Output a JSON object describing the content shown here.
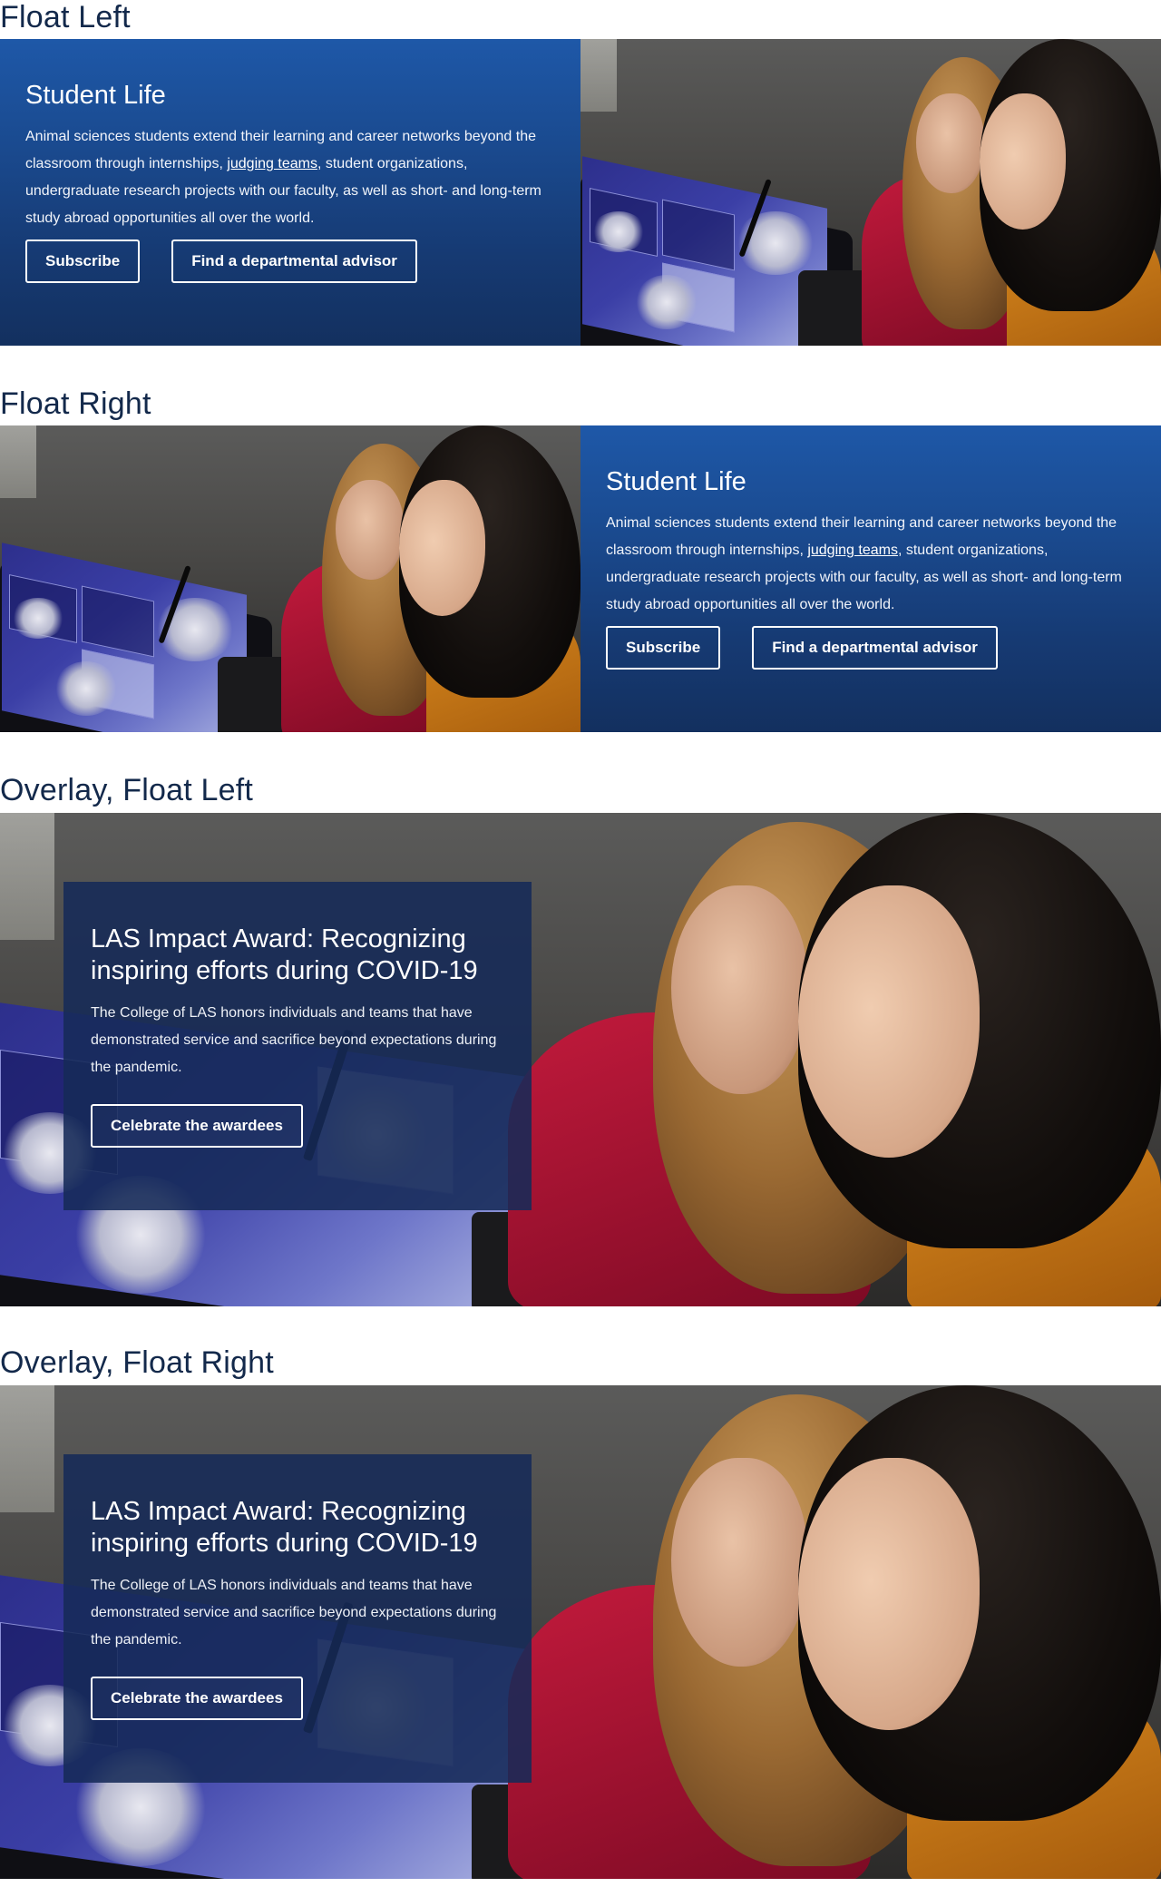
{
  "sections": {
    "float_left": {
      "heading": "Float Left",
      "title": "Student Life",
      "body_before_link": "Animal sciences students extend their learning and career networks beyond the classroom through internships, ",
      "link_text": "judging teams",
      "body_after_link": ", student organizations, undergraduate research projects with our faculty, as well as short- and long-term study abroad opportunities all over the world.",
      "buttons": [
        "Subscribe",
        "Find a departmental advisor"
      ]
    },
    "float_right": {
      "heading": "Float Right",
      "title": "Student Life",
      "body_before_link": "Animal sciences students extend their learning and career networks beyond the classroom through internships, ",
      "link_text": "judging teams",
      "body_after_link": ", student organizations, undergraduate research projects with our faculty, as well as short- and long-term study abroad opportunities all over the world.",
      "buttons": [
        "Subscribe",
        "Find a departmental advisor"
      ]
    },
    "overlay_float_left": {
      "heading": "Overlay, Float Left",
      "title": "LAS Impact Award: Recognizing inspiring efforts during COVID-19",
      "body": "The College of LAS honors individuals and teams that have demonstrated service and sacrifice beyond expectations during the pandemic.",
      "button": "Celebrate the awardees"
    },
    "overlay_float_right": {
      "heading": "Overlay, Float Right",
      "title": "LAS Impact Award: Recognizing inspiring efforts during COVID-19",
      "body": "The College of LAS honors individuals and teams that have demonstrated service and sacrifice beyond expectations during the pandemic.",
      "button": "Celebrate the awardees"
    }
  },
  "colors": {
    "heading": "#13294b",
    "panel_top": "#1e58a8",
    "panel_bottom": "#13305f",
    "overlay": "#162a58"
  }
}
